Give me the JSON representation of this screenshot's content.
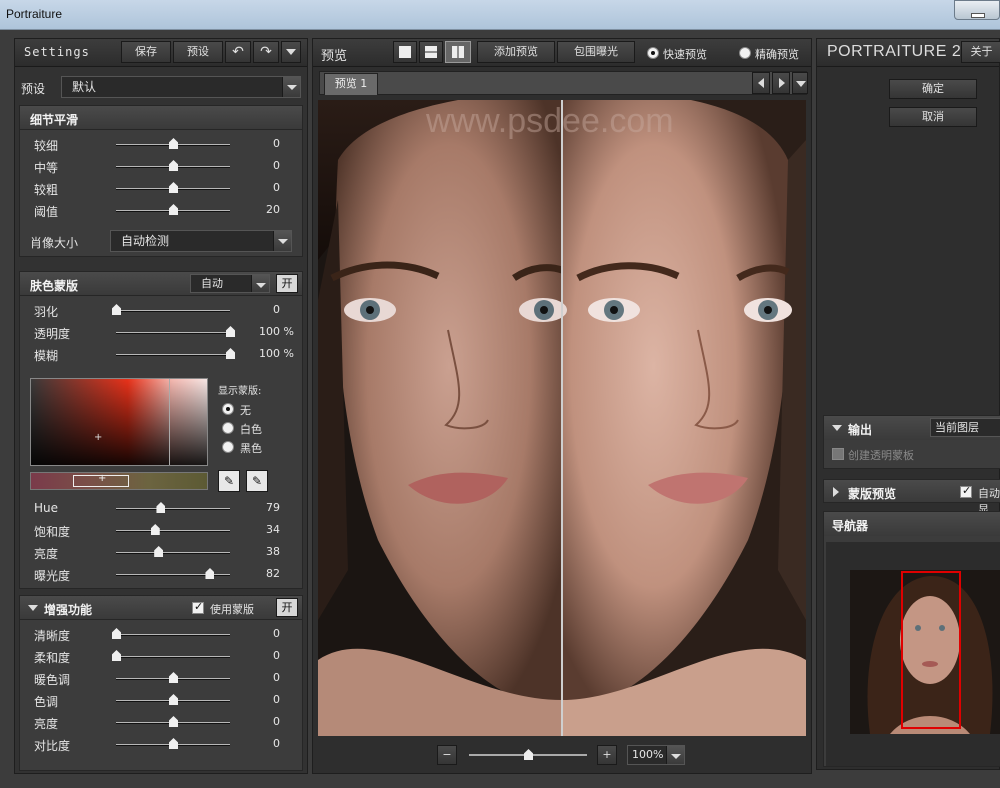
{
  "window": {
    "title": "Portraiture"
  },
  "left": {
    "settings_label": "Settings",
    "save_label": "保存",
    "preset_btn_label": "预设",
    "preset_label": "预设",
    "preset_value": "默认",
    "detail": {
      "title": "细节平滑",
      "sliders": [
        {
          "name": "较细",
          "value": "0",
          "pos": 0.5
        },
        {
          "name": "中等",
          "value": "0",
          "pos": 0.5
        },
        {
          "name": "较粗",
          "value": "0",
          "pos": 0.5
        },
        {
          "name": "阈值",
          "value": "20",
          "pos": 0.5
        }
      ],
      "portrait_size_label": "肖像大小",
      "portrait_size_value": "自动检测"
    },
    "skin": {
      "title": "肤色蒙版",
      "mode_value": "自动",
      "toggle_label": "开",
      "sliders": [
        {
          "name": "羽化",
          "value": "0",
          "pct": "",
          "pos": 0.0
        },
        {
          "name": "透明度",
          "value": "100",
          "pct": "%",
          "pos": 1.0
        },
        {
          "name": "模糊",
          "value": "100",
          "pct": "%",
          "pos": 1.0
        }
      ],
      "show_mask_label": "显示蒙版:",
      "radio_none": "无",
      "radio_white": "白色",
      "radio_black": "黑色",
      "hsl": [
        {
          "name": "Hue",
          "value": "79",
          "pos": 0.39
        },
        {
          "name": "饱和度",
          "value": "34",
          "pos": 0.34
        },
        {
          "name": "亮度",
          "value": "38",
          "pos": 0.37
        },
        {
          "name": "曝光度",
          "value": "82",
          "pos": 0.82
        }
      ]
    },
    "enhance": {
      "title": "增强功能",
      "use_mask_label": "使用蒙版",
      "toggle_label": "开",
      "sliders": [
        {
          "name": "清晰度",
          "value": "0",
          "pos": 0.0
        },
        {
          "name": "柔和度",
          "value": "0",
          "pos": 0.0
        },
        {
          "name": "暖色调",
          "value": "0",
          "pos": 0.5
        },
        {
          "name": "色调",
          "value": "0",
          "pos": 0.5
        },
        {
          "name": "亮度",
          "value": "0",
          "pos": 0.5
        },
        {
          "name": "对比度",
          "value": "0",
          "pos": 0.5
        }
      ]
    }
  },
  "center": {
    "preview_label": "预览",
    "add_preview_label": "添加预览",
    "clip_exposure_label": "包围曝光",
    "fast_preview_label": "快速预览",
    "accurate_preview_label": "精确预览",
    "tab_label": "预览 1",
    "watermark": "www.psdee.com",
    "zoom_minus": "−",
    "zoom_plus": "+",
    "zoom_value": "100%"
  },
  "right": {
    "logo": "PORTRAITURE 2",
    "about_label": "关于",
    "ok_label": "确定",
    "cancel_label": "取消",
    "output_title": "输出",
    "output_value": "当前图层",
    "create_mask_label": "创建透明蒙板",
    "mask_preview_title": "蒙版预览",
    "auto_label": "自动显",
    "navigator_title": "导航器"
  },
  "colors": {
    "nav_box": "#e00000",
    "mask_red": "#e8321a"
  }
}
